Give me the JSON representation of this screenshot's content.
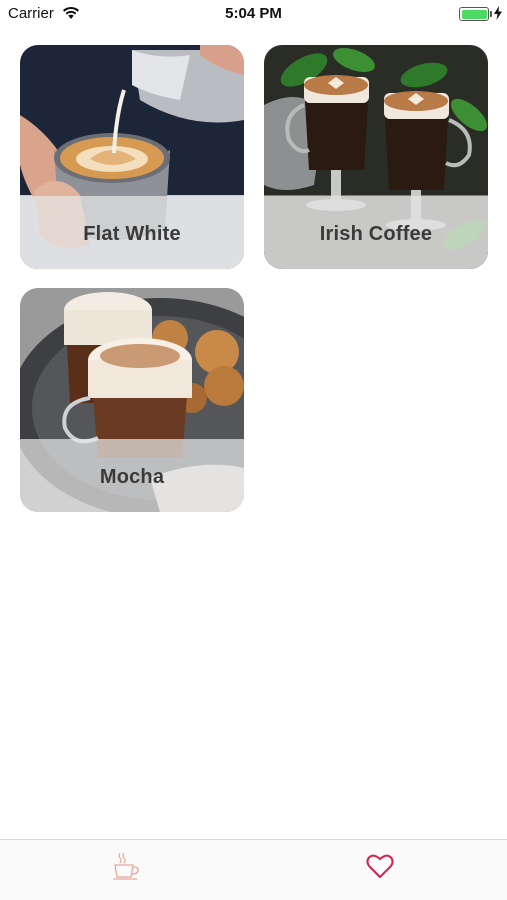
{
  "status_bar": {
    "carrier": "Carrier",
    "time": "5:04 PM",
    "battery_level": 1.0
  },
  "drinks": [
    {
      "name": "Flat White"
    },
    {
      "name": "Irish Coffee"
    },
    {
      "name": "Mocha"
    }
  ],
  "tab_bar": {
    "tabs": [
      {
        "icon": "coffee-cup-icon",
        "color": "#e8a79a"
      },
      {
        "icon": "heart-icon",
        "color": "#d7204a"
      }
    ]
  }
}
